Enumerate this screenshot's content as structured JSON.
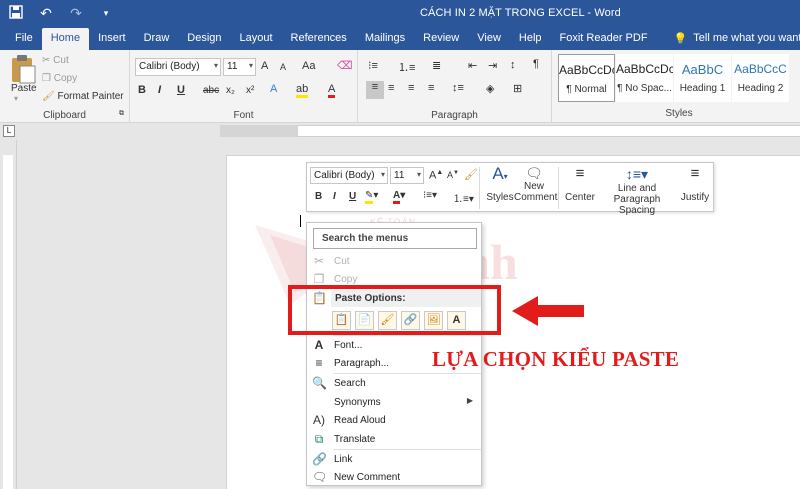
{
  "titlebar": {
    "title": "CÁCH IN 2 MẶT TRONG EXCEL  -  Word",
    "icons": [
      "save-icon",
      "undo-icon",
      "redo-icon",
      "customize-qat-icon"
    ]
  },
  "tabs": [
    {
      "label": "File"
    },
    {
      "label": "Home"
    },
    {
      "label": "Insert"
    },
    {
      "label": "Draw"
    },
    {
      "label": "Design"
    },
    {
      "label": "Layout"
    },
    {
      "label": "References"
    },
    {
      "label": "Mailings"
    },
    {
      "label": "Review"
    },
    {
      "label": "View"
    },
    {
      "label": "Help"
    },
    {
      "label": "Foxit Reader PDF"
    }
  ],
  "tell_me": "Tell me what you want to do",
  "clipboard": {
    "paste": "Paste",
    "cut": "Cut",
    "copy": "Copy",
    "format_painter": "Format Painter",
    "label": "Clipboard"
  },
  "font": {
    "family": "Calibri (Body)",
    "size": "11",
    "grow": "A",
    "shrink": "A",
    "case": "Aa",
    "bold": "B",
    "italic": "I",
    "underline": "U",
    "strike": "abc",
    "sub": "x₂",
    "sup": "x²",
    "label": "Font"
  },
  "paragraph": {
    "label": "Paragraph"
  },
  "styles": {
    "items": [
      {
        "preview": "AaBbCcDc",
        "name": "¶ Normal"
      },
      {
        "preview": "AaBbCcDc",
        "name": "¶ No Spac..."
      },
      {
        "preview": "AaBbC",
        "name": "Heading 1"
      },
      {
        "preview": "AaBbCcC",
        "name": "Heading 2"
      }
    ],
    "label": "Styles"
  },
  "minibar": {
    "font": "Calibri (Body)",
    "size": "11",
    "styles": "Styles",
    "new_comment": "New Comment",
    "center": "Center",
    "line_spacing": "Line and Paragraph Spacing",
    "justify": "Justify"
  },
  "watermark": {
    "top": "KẾ TOÁN",
    "main": "Lê Ánh"
  },
  "context_menu": {
    "search": "Search the menus",
    "cut": "Cut",
    "copy": "Copy",
    "paste_options": "Paste Options:",
    "paste_icons": [
      "paste-keep-source-icon",
      "paste-merge-icon",
      "paste-picture-icon",
      "paste-link-icon",
      "paste-image-icon",
      "paste-text-only-icon"
    ],
    "font": "Font...",
    "paragraph": "Paragraph...",
    "search_item": "Search",
    "synonyms": "Synonyms",
    "read_aloud": "Read Aloud",
    "translate": "Translate",
    "link": "Link",
    "new_comment": "New Comment"
  },
  "annotation": {
    "callout": "LỰA CHỌN KIỂU PASTE",
    "color": "#e21b1b"
  }
}
